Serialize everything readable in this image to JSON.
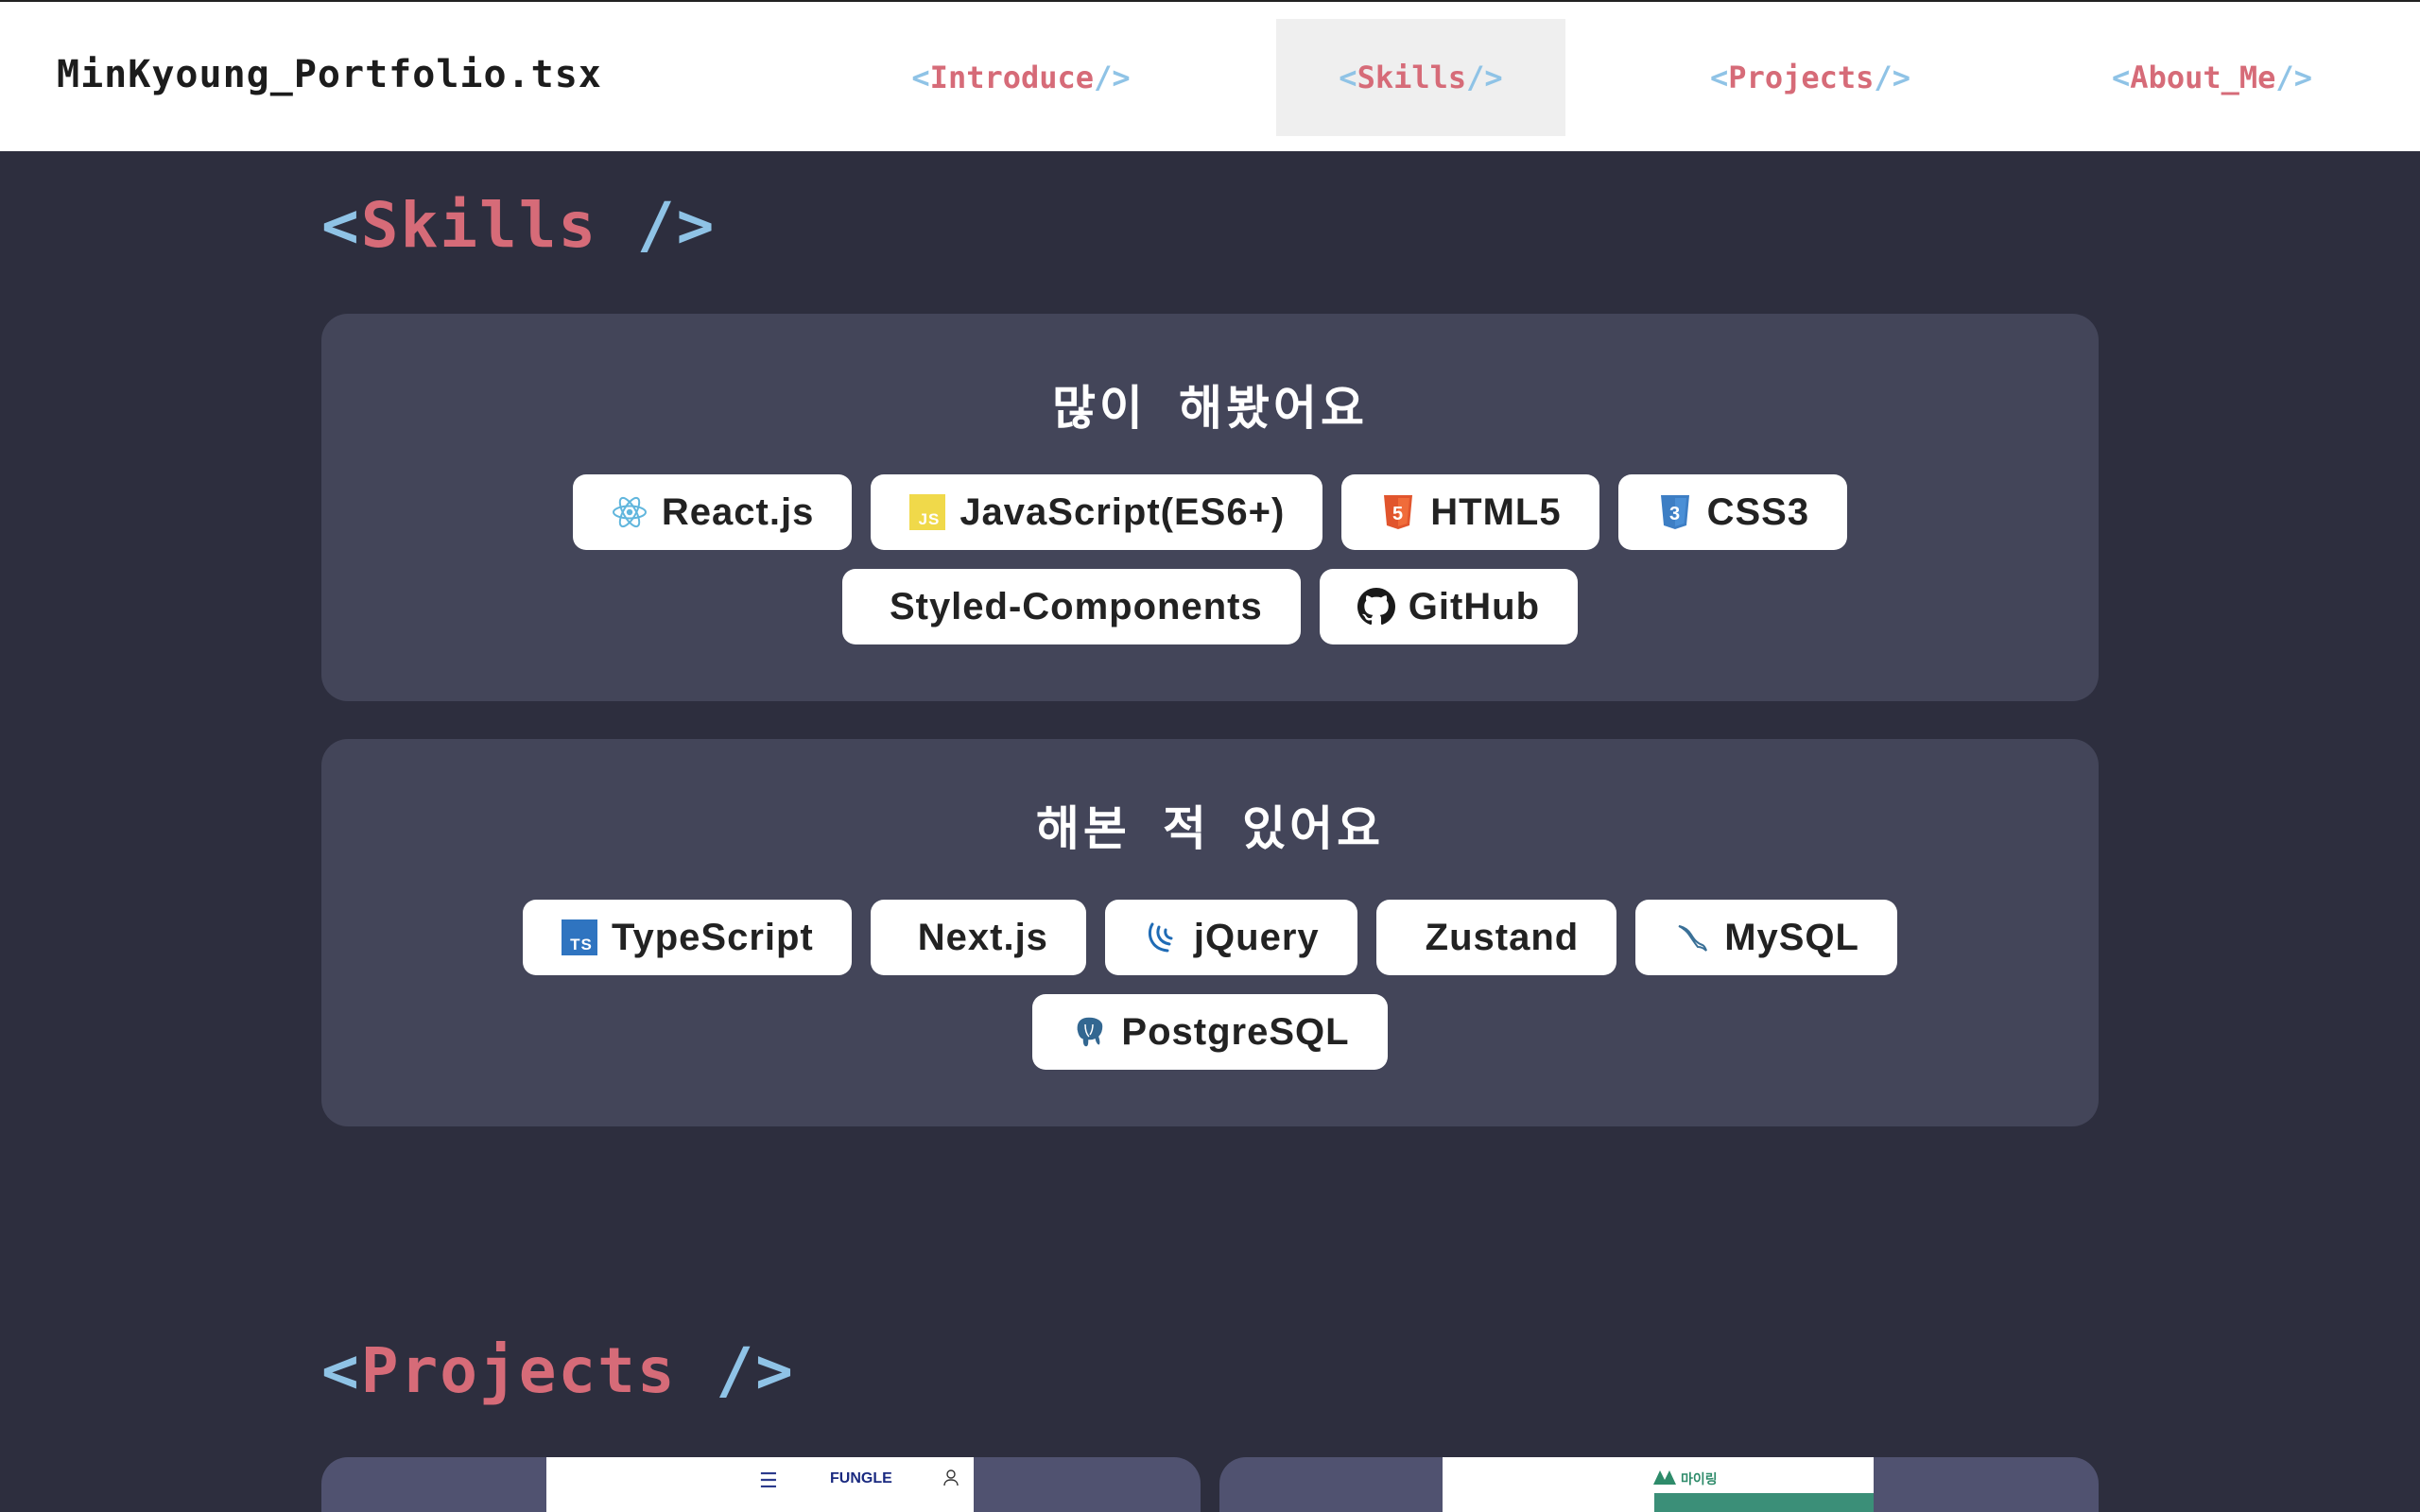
{
  "navbar": {
    "brand": "MinKyoung_Portfolio.tsx",
    "tabs": [
      {
        "open": "<",
        "label": "Introduce",
        "close": " />"
      },
      {
        "open": "<",
        "label": "Skills",
        "close": " />"
      },
      {
        "open": "<",
        "label": "Projects",
        "close": " />"
      },
      {
        "open": "<",
        "label": "About_Me",
        "close": " />"
      }
    ],
    "active_tab": "Skills"
  },
  "skills_section": {
    "heading": {
      "open": "<",
      "label": "Skills",
      "close": " />"
    },
    "groups": [
      {
        "title": "많이 해봤어요",
        "chips": [
          {
            "label": "React.js",
            "icon": "react-icon"
          },
          {
            "label": "JavaScript(ES6+)",
            "icon": "javascript-icon"
          },
          {
            "label": "HTML5",
            "icon": "html5-icon"
          },
          {
            "label": "CSS3",
            "icon": "css3-icon"
          },
          {
            "label": "Styled-Components",
            "icon": ""
          },
          {
            "label": "GitHub",
            "icon": "github-icon"
          }
        ]
      },
      {
        "title": "해본 적 있어요",
        "chips": [
          {
            "label": "TypeScript",
            "icon": "typescript-icon"
          },
          {
            "label": "Next.js",
            "icon": ""
          },
          {
            "label": "jQuery",
            "icon": "jquery-icon"
          },
          {
            "label": "Zustand",
            "icon": ""
          },
          {
            "label": "MySQL",
            "icon": "mysql-icon"
          },
          {
            "label": "PostgreSQL",
            "icon": "postgresql-icon"
          }
        ]
      }
    ]
  },
  "projects_section": {
    "heading": {
      "open": "<",
      "label": "Projects",
      "close": " />"
    },
    "cards": [
      {
        "thumb_brand": "FUNGLE"
      },
      {
        "thumb_brand": "마이링"
      }
    ]
  },
  "colors": {
    "background": "#2d2e3e",
    "card": "#434559",
    "tag": "#d66b78",
    "bracket": "#8fc3e6"
  }
}
